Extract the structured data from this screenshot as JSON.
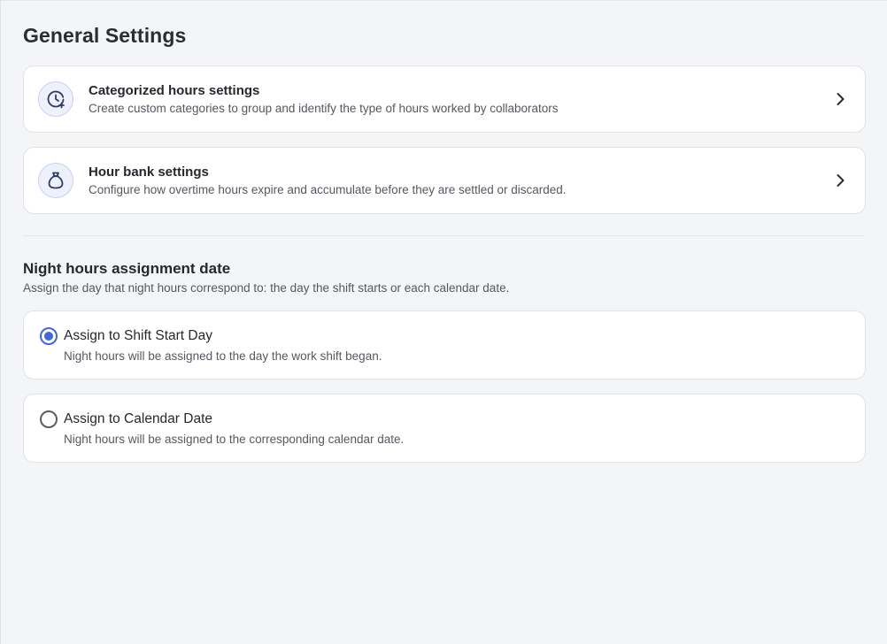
{
  "page": {
    "title": "General Settings"
  },
  "cards": [
    {
      "title": "Categorized hours settings",
      "description": "Create custom categories to group and identify the type of hours worked by collaborators",
      "icon": "clock-plus-icon"
    },
    {
      "title": "Hour bank settings",
      "description": "Configure how overtime hours expire and accumulate before they are settled or discarded.",
      "icon": "money-bag-icon"
    }
  ],
  "night_hours": {
    "title": "Night hours assignment date",
    "description": "Assign the day that night hours correspond to: the day the shift starts or each calendar date.",
    "options": [
      {
        "label": "Assign to Shift Start Day",
        "description": "Night hours will be assigned to the day the work shift began.",
        "selected": true
      },
      {
        "label": "Assign to Calendar Date",
        "description": "Night hours will be assigned to the corresponding calendar date.",
        "selected": false
      }
    ]
  },
  "colors": {
    "accent": "#4467d8",
    "background": "#f4f5f7",
    "card": "#ffffff",
    "icon_bg": "#eef1fb",
    "icon_stroke": "#2d3a6b"
  }
}
